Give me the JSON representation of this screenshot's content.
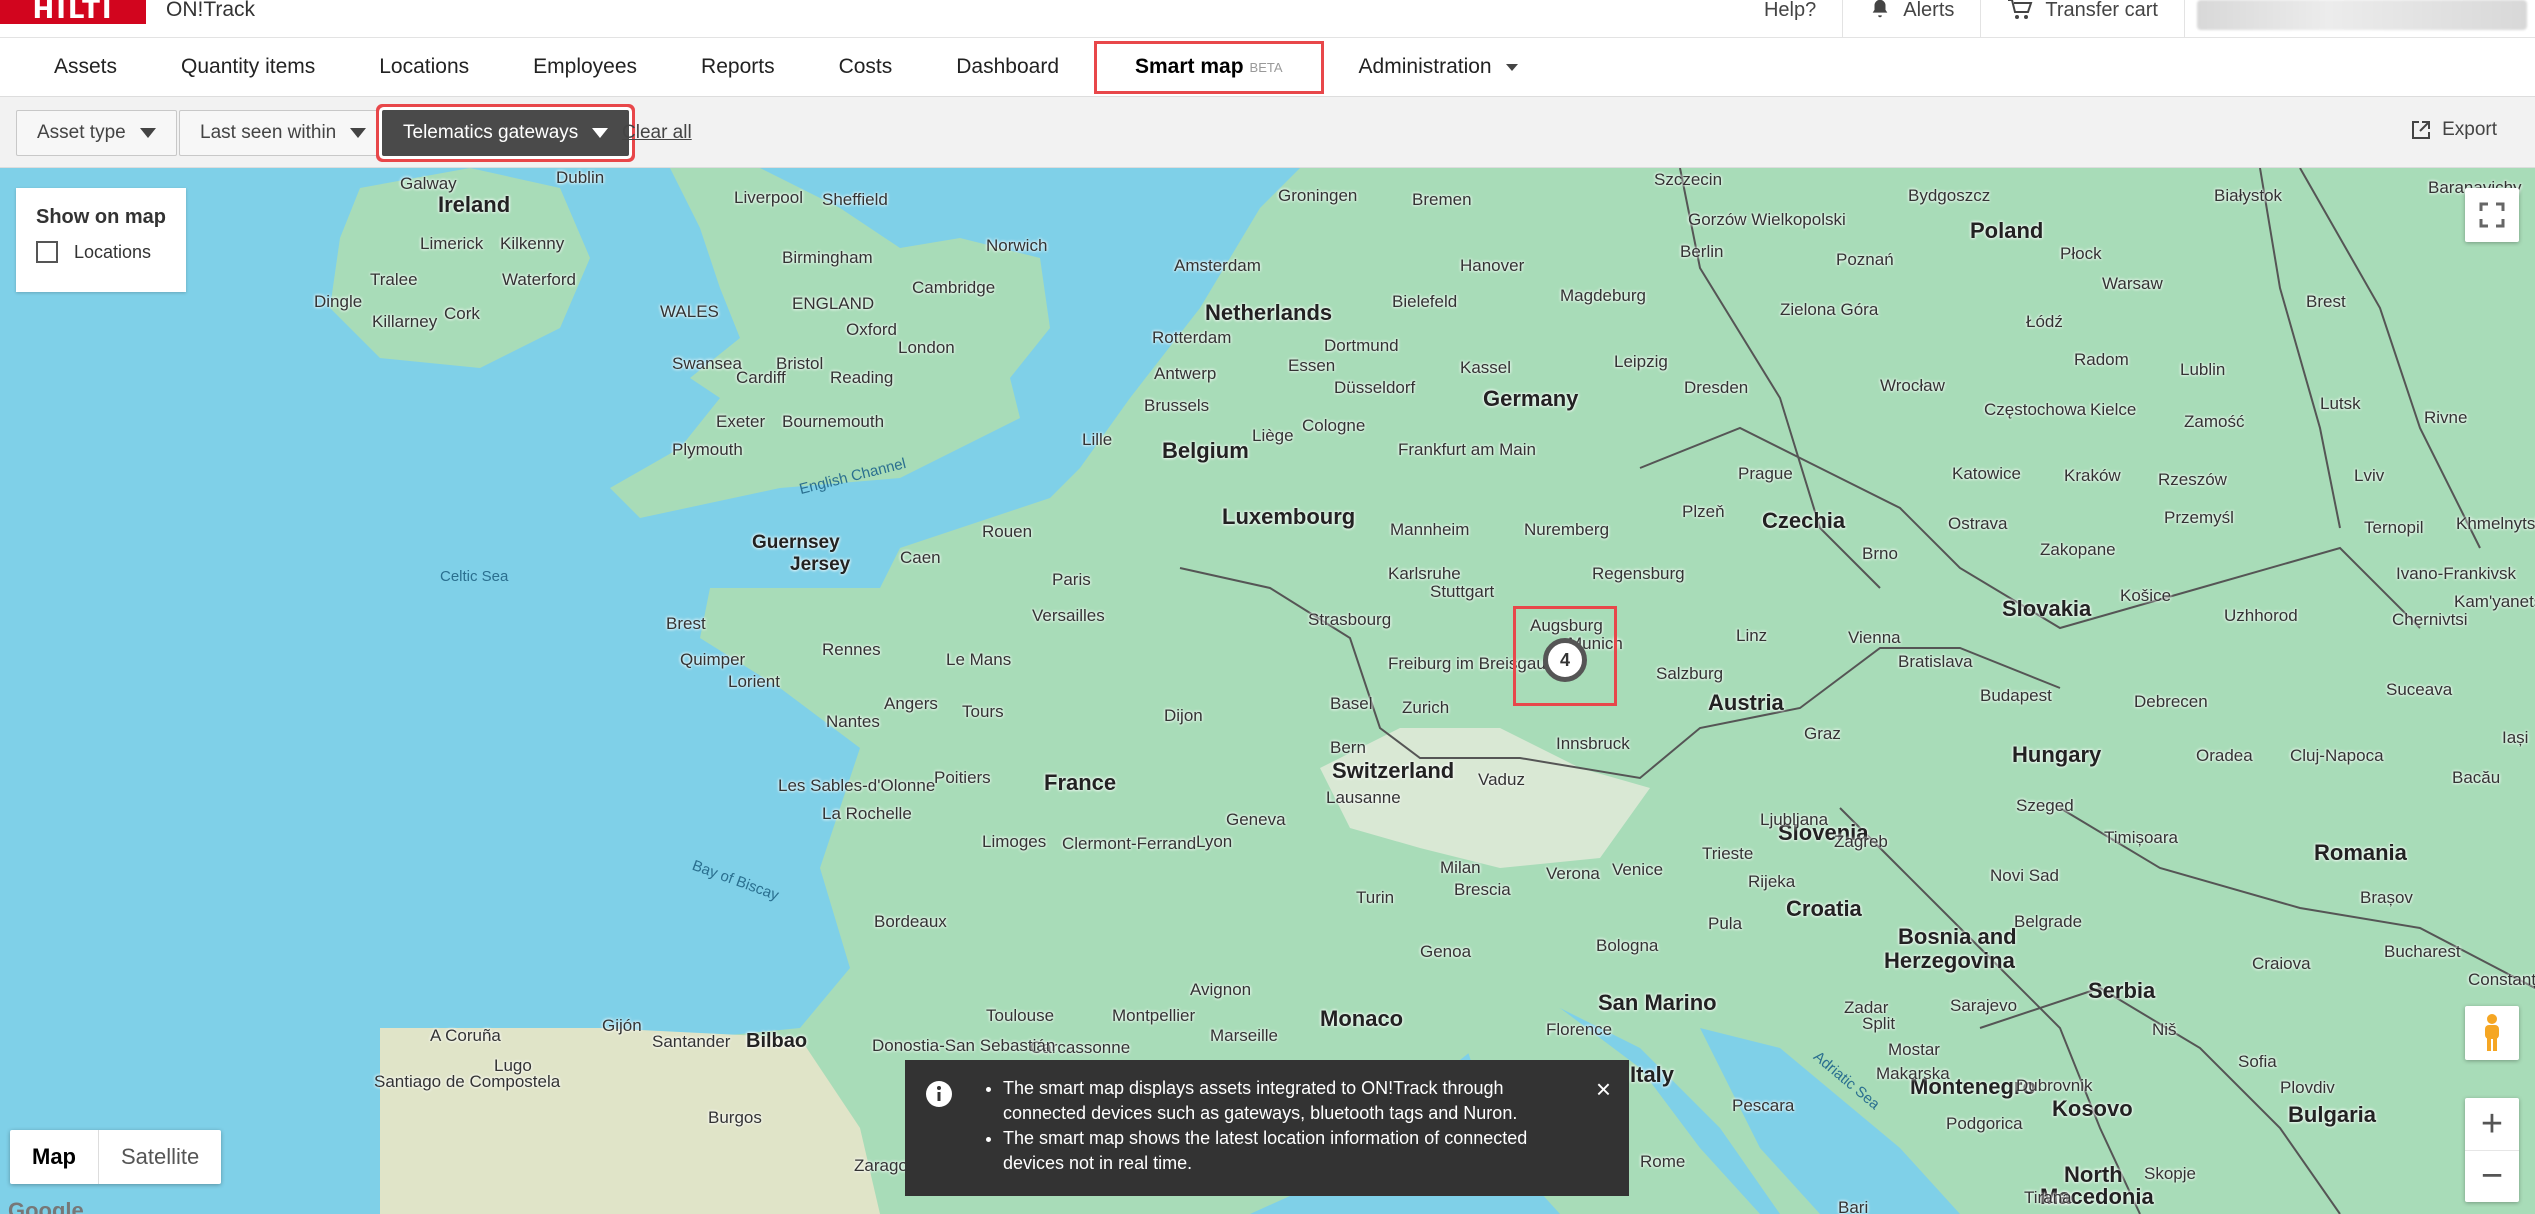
{
  "topbar": {
    "logo": "HILTI",
    "app_name": "ON!Track",
    "help": "Help?",
    "alerts": "Alerts",
    "transfer_cart": "Transfer cart"
  },
  "nav": {
    "items": [
      "Assets",
      "Quantity items",
      "Locations",
      "Employees",
      "Reports",
      "Costs",
      "Dashboard"
    ],
    "smart_map": "Smart map",
    "beta": "BETA",
    "administration": "Administration"
  },
  "filters": {
    "asset_type": "Asset type",
    "last_seen": "Last seen within",
    "telematics": "Telematics gateways",
    "clear_all": "Clear all",
    "export": "Export"
  },
  "map": {
    "show_on_map": "Show on map",
    "locations": "Locations",
    "cluster_count": "4",
    "map_btn": "Map",
    "satellite_btn": "Satellite",
    "google": "Google",
    "zoom_in": "+",
    "zoom_out": "−",
    "countries": [
      "Ireland",
      "Poland",
      "Netherlands",
      "Germany",
      "Belgium",
      "Luxembourg",
      "Czechia",
      "Slovakia",
      "Austria",
      "Hungary",
      "France",
      "Switzerland",
      "Slovenia",
      "Croatia",
      "Romania",
      "Bosnia and",
      "Herzegovina",
      "Serbia",
      "Monaco",
      "San Marino",
      "Italy",
      "Montenegro",
      "Kosovo",
      "Bulgaria",
      "North",
      "Macedonia"
    ],
    "cities": [
      "Galway",
      "Dublin",
      "Liverpool",
      "Sheffield",
      "Limerick",
      "Kilkenny",
      "Tralee",
      "Waterford",
      "Dingle",
      "Cork",
      "Killarney",
      "Birmingham",
      "WALES",
      "ENGLAND",
      "Oxford",
      "Cambridge",
      "Norwich",
      "Bristol",
      "Cardiff",
      "Swansea",
      "Reading",
      "London",
      "Exeter",
      "Bournemouth",
      "Plymouth",
      "English Channel",
      "Guernsey",
      "Jersey",
      "Caen",
      "Rouen",
      "Celtic Sea",
      "Brest",
      "Quimper",
      "Lorient",
      "Rennes",
      "Le Mans",
      "Paris",
      "Versailles",
      "Nantes",
      "Angers",
      "Tours",
      "Dijon",
      "Les Sables-d'Olonne",
      "Poitiers",
      "La Rochelle",
      "Limoges",
      "Clermont-Ferrand",
      "Lyon",
      "Bay of Biscay",
      "Bordeaux",
      "Toulouse",
      "Montpellier",
      "Marseille",
      "Avignon",
      "Carcassonne",
      "Genoa",
      "A Coruña",
      "Lugo",
      "Gijón",
      "Santander",
      "Bilbao",
      "Donostia-San Sebastián",
      "Santiago de Compostela",
      "Burgos",
      "Zaragoza",
      "Groningen",
      "Amsterdam",
      "Rotterdam",
      "Antwerp",
      "Brussels",
      "Liège",
      "Lille",
      "Bremen",
      "Hanover",
      "Bielefeld",
      "Dortmund",
      "Essen",
      "Düsseldorf",
      "Cologne",
      "Kassel",
      "Frankfurt am Main",
      "Mannheim",
      "Karlsruhe",
      "Stuttgart",
      "Strasbourg",
      "Freiburg im Breisgau",
      "Zurich",
      "Basel",
      "Bern",
      "Lausanne",
      "Geneva",
      "Nuremberg",
      "Regensburg",
      "Augsburg",
      "Munich",
      "Innsbruck",
      "Salzburg",
      "Linz",
      "Vienna",
      "Graz",
      "Bratislava",
      "Budapest",
      "Szczecin",
      "Gorzów Wielkopolski",
      "Bydgoszcz",
      "Białystok",
      "Baranavichy",
      "Berlin",
      "Poznań",
      "Płock",
      "Warsaw",
      "Magdeburg",
      "Zielona Góra",
      "Łódź",
      "Leipzig",
      "Dresden",
      "Wrocław",
      "Radom",
      "Lublin",
      "Brest",
      "Lutsk",
      "Rivne",
      "Częstochowa",
      "Kielce",
      "Zamość",
      "Katowice",
      "Kraków",
      "Rzeszów",
      "Lviv",
      "Prague",
      "Plzeň",
      "Brno",
      "Ostrava",
      "Zakopane",
      "Przemyśl",
      "Ternopil",
      "Khmelnytskyi",
      "Ivano-Frankivsk",
      "Košice",
      "Uzhhorod",
      "Chernivtsi",
      "Kam'yanets'-Podil's'kyi",
      "Debrecen",
      "Suceava",
      "Iași",
      "Bacău",
      "Oradea",
      "Cluj-Napoca",
      "Szeged",
      "Timișoara",
      "Novi Sad",
      "Belgrade",
      "Brașov",
      "Bucharest",
      "Constanța",
      "Craiova",
      "Niš",
      "Sofia",
      "Plovdiv",
      "Skopje",
      "Tirana",
      "Podgorica",
      "Sarajevo",
      "Split",
      "Mostar",
      "Makarska",
      "Dubrovnik",
      "Zadar",
      "Pula",
      "Rijeka",
      "Zagreb",
      "Ljubljana",
      "Trieste",
      "Venice",
      "Verona",
      "Milan",
      "Brescia",
      "Turin",
      "Bologna",
      "Florence",
      "Rome",
      "Bari",
      "Pescara",
      "Adriatic Sea",
      "Vaduz"
    ]
  },
  "toast": {
    "line1": "The smart map displays assets integrated to ON!Track through connected devices such as gateways, bluetooth tags and Nuron.",
    "line2": "The smart map shows the latest location information of connected devices not in real time.",
    "close": "×"
  }
}
